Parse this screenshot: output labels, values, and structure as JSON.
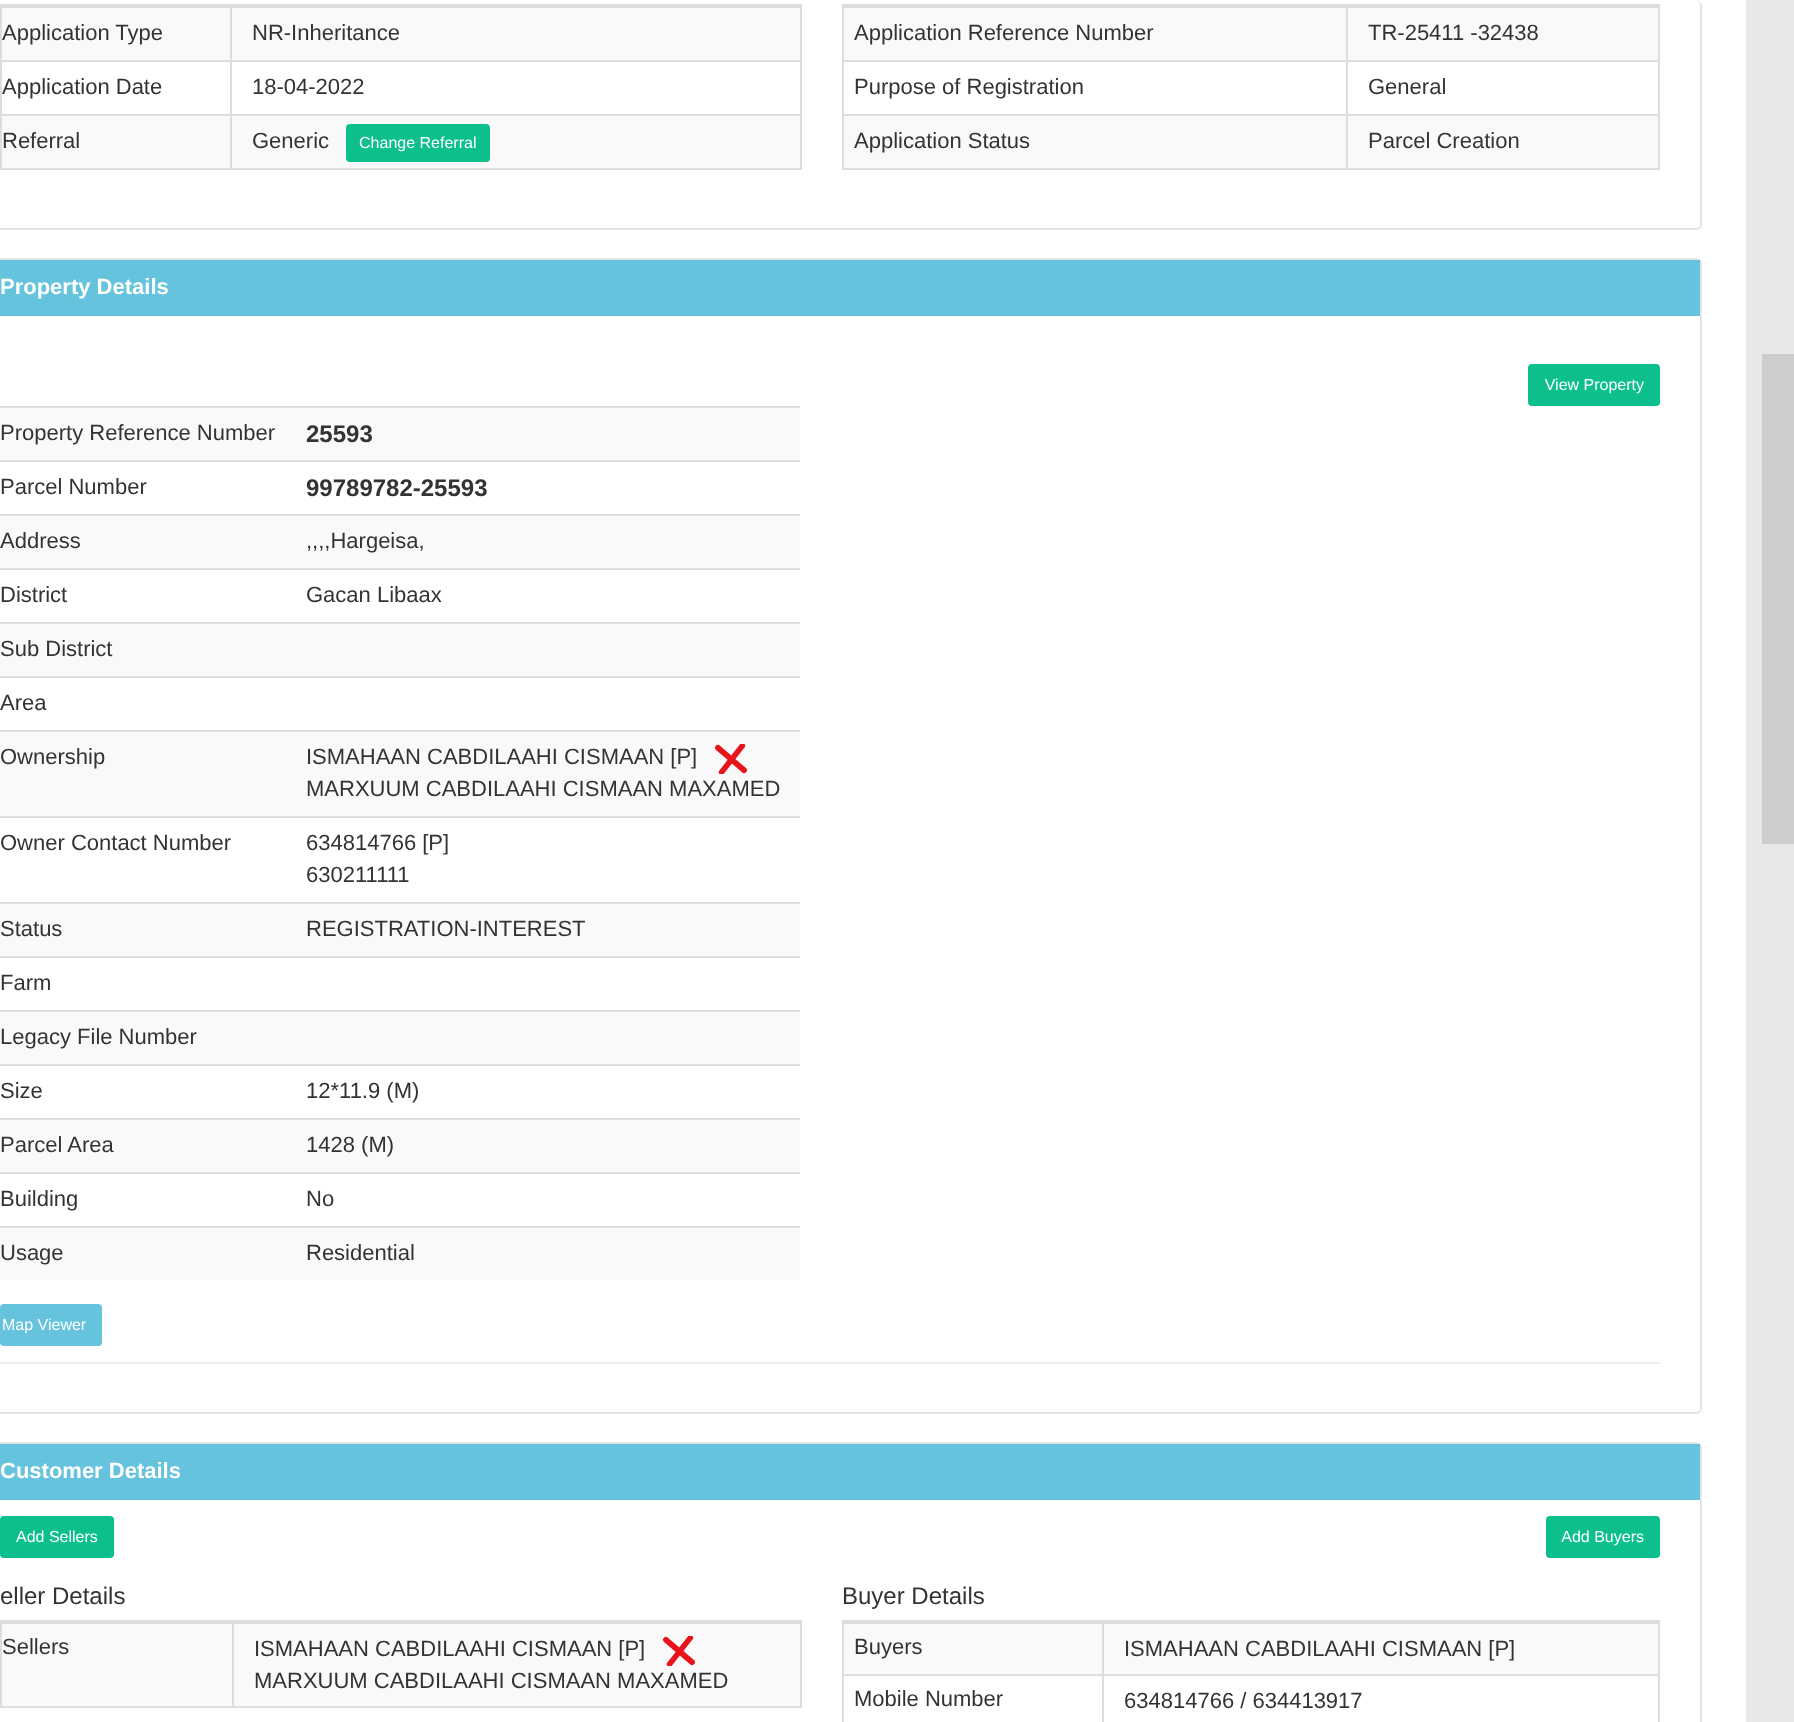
{
  "application": {
    "left_rows": [
      {
        "label": "Application Type",
        "value": "NR-Inheritance"
      },
      {
        "label": "Application Date",
        "value": "18-04-2022"
      },
      {
        "label": "Referral",
        "value": "Generic",
        "button": "Change Referral"
      }
    ],
    "right_rows": [
      {
        "label": "Application Reference Number",
        "value": "TR-25411 -32438"
      },
      {
        "label": "Purpose of Registration",
        "value": "General"
      },
      {
        "label": "Application Status",
        "value": "Parcel Creation"
      }
    ]
  },
  "property": {
    "header": "Property Details",
    "view_button": "View Property",
    "map_button": "Map Viewer",
    "rows": [
      {
        "label": "Property Reference Number",
        "values": [
          "25593"
        ],
        "bold": true,
        "marked": false
      },
      {
        "label": "Parcel Number",
        "values": [
          "99789782-25593"
        ],
        "bold": true,
        "marked": false
      },
      {
        "label": "Address",
        "values": [
          ",,,,Hargeisa,"
        ],
        "bold": false,
        "marked": false
      },
      {
        "label": "District",
        "values": [
          "Gacan Libaax"
        ],
        "bold": false,
        "marked": false
      },
      {
        "label": "Sub District",
        "values": [],
        "bold": false,
        "marked": false
      },
      {
        "label": "Area",
        "values": [],
        "bold": false,
        "marked": false
      },
      {
        "label": "Ownership",
        "values": [
          "ISMAHAAN CABDILAAHI CISMAAN [P]",
          "MARXUUM CABDILAAHI CISMAAN MAXAMED"
        ],
        "bold": false,
        "marked": true
      },
      {
        "label": "Owner Contact Number",
        "values": [
          "634814766 [P]",
          "630211111"
        ],
        "bold": false,
        "marked": false
      },
      {
        "label": "Status",
        "values": [
          "REGISTRATION-INTEREST"
        ],
        "bold": false,
        "marked": false
      },
      {
        "label": "Farm",
        "values": [],
        "bold": false,
        "marked": false
      },
      {
        "label": "Legacy File Number",
        "values": [],
        "bold": false,
        "marked": false
      },
      {
        "label": "Size",
        "values": [
          "12*11.9 (M)"
        ],
        "bold": false,
        "marked": false
      },
      {
        "label": "Parcel Area",
        "values": [
          "1428 (M)"
        ],
        "bold": false,
        "marked": false
      },
      {
        "label": "Building",
        "values": [
          "No"
        ],
        "bold": false,
        "marked": false
      },
      {
        "label": "Usage",
        "values": [
          "Residential"
        ],
        "bold": false,
        "marked": false
      }
    ]
  },
  "customer": {
    "header": "Customer Details",
    "add_sellers": "Add Sellers",
    "add_buyers": "Add Buyers",
    "seller": {
      "title": "eller Details",
      "rows": [
        {
          "label": "Sellers",
          "values": [
            "ISMAHAAN CABDILAAHI CISMAAN [P]",
            "MARXUUM CABDILAAHI CISMAAN MAXAMED"
          ],
          "marked": true
        }
      ]
    },
    "buyer": {
      "title": "Buyer Details",
      "rows": [
        {
          "label": "Buyers",
          "values": [
            "ISMAHAAN CABDILAAHI CISMAAN [P]"
          ],
          "marked": false
        },
        {
          "label": "Mobile Number",
          "values": [
            "634814766 / 634413917"
          ],
          "marked": false
        }
      ]
    }
  }
}
